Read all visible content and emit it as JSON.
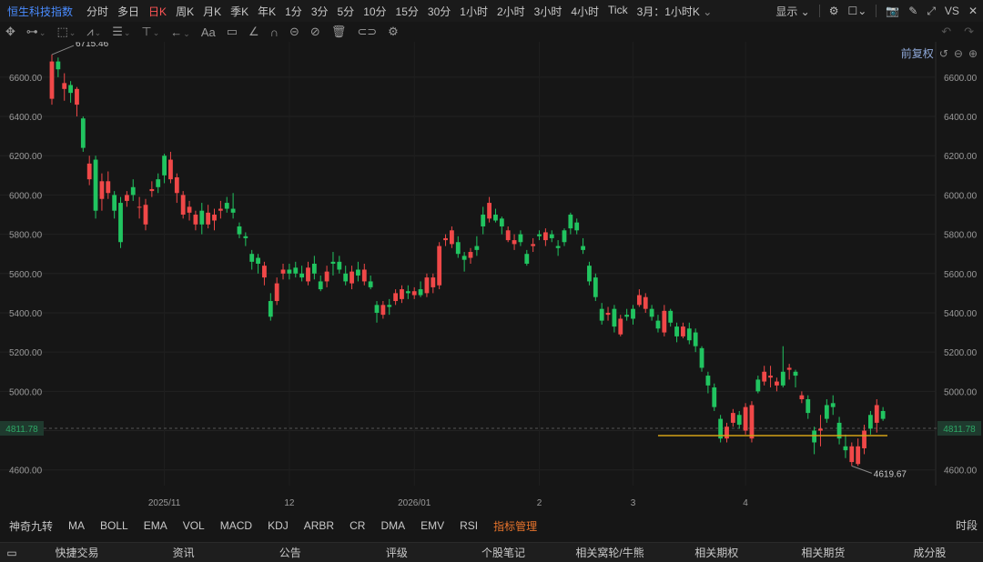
{
  "header": {
    "title": "恒生科技指数",
    "periods": [
      "分时",
      "多日",
      "日K",
      "周K",
      "月K",
      "季K",
      "年K",
      "1分",
      "3分",
      "5分",
      "10分",
      "15分",
      "30分",
      "1小时",
      "2小时",
      "3小时",
      "4小时",
      "Tick"
    ],
    "active_period": "日K",
    "custom_period": "3月：1小时K",
    "display_label": "显示",
    "brand": "VS"
  },
  "price_adjust": "前复权",
  "chart_data": {
    "type": "candlestick",
    "ylim": [
      4520,
      6780
    ],
    "yticks": [
      "6600.00",
      "6400.00",
      "6200.00",
      "6000.00",
      "5800.00",
      "5600.00",
      "5400.00",
      "5200.00",
      "5000.00",
      "4800.00",
      "4600.00"
    ],
    "current_price_label": "4811.78",
    "current_price": 4811.78,
    "high_label": "6715.46",
    "low_label": "4619.67",
    "horizontal_line": 4775,
    "x_labels": [
      {
        "label": "2025/11",
        "i": 18
      },
      {
        "label": "12",
        "i": 38
      },
      {
        "label": "2026/01",
        "i": 58
      },
      {
        "label": "2",
        "i": 78
      },
      {
        "label": "3",
        "i": 93
      },
      {
        "label": "4",
        "i": 111
      }
    ],
    "candles": [
      [
        6490,
        6680,
        6460,
        6715
      ],
      [
        6680,
        6640,
        6600,
        6700
      ],
      [
        6540,
        6570,
        6480,
        6620
      ],
      [
        6560,
        6520,
        6470,
        6580
      ],
      [
        6460,
        6540,
        6400,
        6550
      ],
      [
        6390,
        6240,
        6220,
        6400
      ],
      [
        6080,
        6160,
        6050,
        6200
      ],
      [
        6180,
        5920,
        5880,
        6200
      ],
      [
        5980,
        6070,
        5920,
        6110
      ],
      [
        6010,
        6070,
        5980,
        6120
      ],
      [
        6000,
        5920,
        5880,
        6020
      ],
      [
        5960,
        5760,
        5730,
        5990
      ],
      [
        5970,
        6000,
        5940,
        6020
      ],
      [
        6040,
        6000,
        5970,
        6080
      ],
      [
        5940,
        5940,
        5880,
        5990
      ],
      [
        5850,
        5950,
        5820,
        5980
      ],
      [
        6020,
        6030,
        5990,
        6070
      ],
      [
        6080,
        6040,
        6010,
        6110
      ],
      [
        6200,
        6100,
        6060,
        6210
      ],
      [
        6080,
        6180,
        6060,
        6220
      ],
      [
        6010,
        6090,
        5960,
        6110
      ],
      [
        5900,
        6000,
        5880,
        6020
      ],
      [
        5910,
        5940,
        5870,
        5970
      ],
      [
        5850,
        5900,
        5820,
        5920
      ],
      [
        5920,
        5850,
        5800,
        5960
      ],
      [
        5850,
        5910,
        5830,
        5950
      ],
      [
        5870,
        5900,
        5820,
        5930
      ],
      [
        5920,
        5930,
        5880,
        5970
      ],
      [
        5960,
        5930,
        5910,
        5990
      ],
      [
        5930,
        5910,
        5880,
        6010
      ],
      [
        5840,
        5800,
        5780,
        5860
      ],
      [
        5790,
        5780,
        5740,
        5810
      ],
      [
        5700,
        5660,
        5620,
        5720
      ],
      [
        5680,
        5650,
        5600,
        5700
      ],
      [
        5580,
        5640,
        5540,
        5660
      ],
      [
        5460,
        5380,
        5360,
        5500
      ],
      [
        5460,
        5550,
        5440,
        5580
      ],
      [
        5600,
        5620,
        5570,
        5650
      ],
      [
        5620,
        5600,
        5570,
        5650
      ],
      [
        5630,
        5600,
        5580,
        5660
      ],
      [
        5600,
        5580,
        5560,
        5640
      ],
      [
        5560,
        5630,
        5540,
        5660
      ],
      [
        5650,
        5600,
        5570,
        5690
      ],
      [
        5560,
        5520,
        5510,
        5590
      ],
      [
        5560,
        5610,
        5530,
        5640
      ],
      [
        5660,
        5650,
        5590,
        5710
      ],
      [
        5660,
        5620,
        5600,
        5690
      ],
      [
        5600,
        5560,
        5540,
        5640
      ],
      [
        5550,
        5610,
        5520,
        5640
      ],
      [
        5620,
        5590,
        5560,
        5660
      ],
      [
        5560,
        5620,
        5540,
        5650
      ],
      [
        5560,
        5530,
        5520,
        5590
      ],
      [
        5440,
        5400,
        5350,
        5460
      ],
      [
        5390,
        5440,
        5370,
        5460
      ],
      [
        5440,
        5430,
        5390,
        5470
      ],
      [
        5460,
        5500,
        5440,
        5520
      ],
      [
        5470,
        5520,
        5450,
        5540
      ],
      [
        5510,
        5500,
        5470,
        5540
      ],
      [
        5490,
        5510,
        5470,
        5530
      ],
      [
        5520,
        5490,
        5480,
        5560
      ],
      [
        5500,
        5580,
        5480,
        5600
      ],
      [
        5530,
        5580,
        5500,
        5600
      ],
      [
        5540,
        5740,
        5520,
        5760
      ],
      [
        5770,
        5780,
        5740,
        5800
      ],
      [
        5750,
        5820,
        5730,
        5840
      ],
      [
        5760,
        5700,
        5680,
        5790
      ],
      [
        5690,
        5670,
        5610,
        5710
      ],
      [
        5680,
        5710,
        5650,
        5730
      ],
      [
        5740,
        5720,
        5690,
        5790
      ],
      [
        5900,
        5840,
        5800,
        5940
      ],
      [
        5880,
        5960,
        5860,
        5990
      ],
      [
        5900,
        5870,
        5860,
        5930
      ],
      [
        5880,
        5840,
        5800,
        5890
      ],
      [
        5770,
        5820,
        5760,
        5840
      ],
      [
        5750,
        5770,
        5720,
        5800
      ],
      [
        5800,
        5760,
        5740,
        5820
      ],
      [
        5700,
        5650,
        5640,
        5720
      ],
      [
        5740,
        5750,
        5710,
        5780
      ],
      [
        5800,
        5790,
        5770,
        5820
      ],
      [
        5770,
        5810,
        5740,
        5830
      ],
      [
        5800,
        5780,
        5760,
        5820
      ],
      [
        5740,
        5730,
        5690,
        5770
      ],
      [
        5820,
        5760,
        5740,
        5830
      ],
      [
        5900,
        5830,
        5800,
        5910
      ],
      [
        5860,
        5820,
        5800,
        5880
      ],
      [
        5740,
        5720,
        5700,
        5780
      ],
      [
        5640,
        5560,
        5540,
        5660
      ],
      [
        5580,
        5480,
        5460,
        5600
      ],
      [
        5420,
        5360,
        5340,
        5450
      ],
      [
        5390,
        5400,
        5360,
        5430
      ],
      [
        5420,
        5330,
        5300,
        5440
      ],
      [
        5290,
        5370,
        5280,
        5390
      ],
      [
        5390,
        5380,
        5360,
        5420
      ],
      [
        5420,
        5370,
        5340,
        5440
      ],
      [
        5440,
        5490,
        5430,
        5520
      ],
      [
        5420,
        5480,
        5400,
        5500
      ],
      [
        5420,
        5380,
        5360,
        5440
      ],
      [
        5360,
        5320,
        5300,
        5390
      ],
      [
        5300,
        5410,
        5280,
        5440
      ],
      [
        5410,
        5350,
        5330,
        5420
      ],
      [
        5330,
        5280,
        5250,
        5350
      ],
      [
        5280,
        5330,
        5270,
        5350
      ],
      [
        5320,
        5260,
        5240,
        5350
      ],
      [
        5300,
        5230,
        5200,
        5320
      ],
      [
        5220,
        5120,
        5100,
        5230
      ],
      [
        5080,
        5030,
        4990,
        5100
      ],
      [
        5020,
        4920,
        4900,
        5040
      ],
      [
        4860,
        4760,
        4740,
        4880
      ],
      [
        4760,
        4820,
        4740,
        4840
      ],
      [
        4840,
        4890,
        4820,
        4910
      ],
      [
        4880,
        4830,
        4810,
        4900
      ],
      [
        4800,
        4920,
        4780,
        4940
      ],
      [
        4760,
        4930,
        4740,
        4950
      ],
      [
        5060,
        5000,
        4990,
        5080
      ],
      [
        5050,
        5100,
        5030,
        5130
      ],
      [
        5070,
        5080,
        5020,
        5130
      ],
      [
        5030,
        5050,
        5000,
        5070
      ],
      [
        5100,
        5030,
        5020,
        5230
      ],
      [
        5110,
        5120,
        5060,
        5140
      ],
      [
        5100,
        5080,
        5020,
        5110
      ],
      [
        4960,
        4980,
        4940,
        5000
      ],
      [
        4960,
        4890,
        4860,
        4980
      ],
      [
        4800,
        4740,
        4680,
        4820
      ],
      [
        4800,
        4810,
        4720,
        4880
      ],
      [
        4930,
        4860,
        4840,
        4960
      ],
      [
        4940,
        4920,
        4880,
        4980
      ],
      [
        4840,
        4760,
        4730,
        4870
      ],
      [
        4720,
        4700,
        4660,
        4780
      ],
      [
        4640,
        4720,
        4620,
        4740
      ],
      [
        4630,
        4720,
        4620,
        4760
      ],
      [
        4710,
        4800,
        4680,
        4830
      ],
      [
        4880,
        4810,
        4780,
        4900
      ],
      [
        4840,
        4930,
        4790,
        4960
      ],
      [
        4900,
        4860,
        4850,
        4920
      ]
    ]
  },
  "indicators": [
    "神奇九转",
    "MA",
    "BOLL",
    "EMA",
    "VOL",
    "MACD",
    "KDJ",
    "ARBR",
    "CR",
    "DMA",
    "EMV",
    "RSI",
    "指标管理"
  ],
  "timeline_label": "时段",
  "bottom_tabs": [
    "快捷交易",
    "资讯",
    "公告",
    "评级",
    "个股笔记",
    "相关窝轮/牛熊",
    "相关期权",
    "相关期货",
    "成分股"
  ],
  "colors": {
    "up": "#f04848",
    "down": "#21c460",
    "accent": "#4a8cff",
    "hline": "#d4a017",
    "bg": "#161616"
  }
}
